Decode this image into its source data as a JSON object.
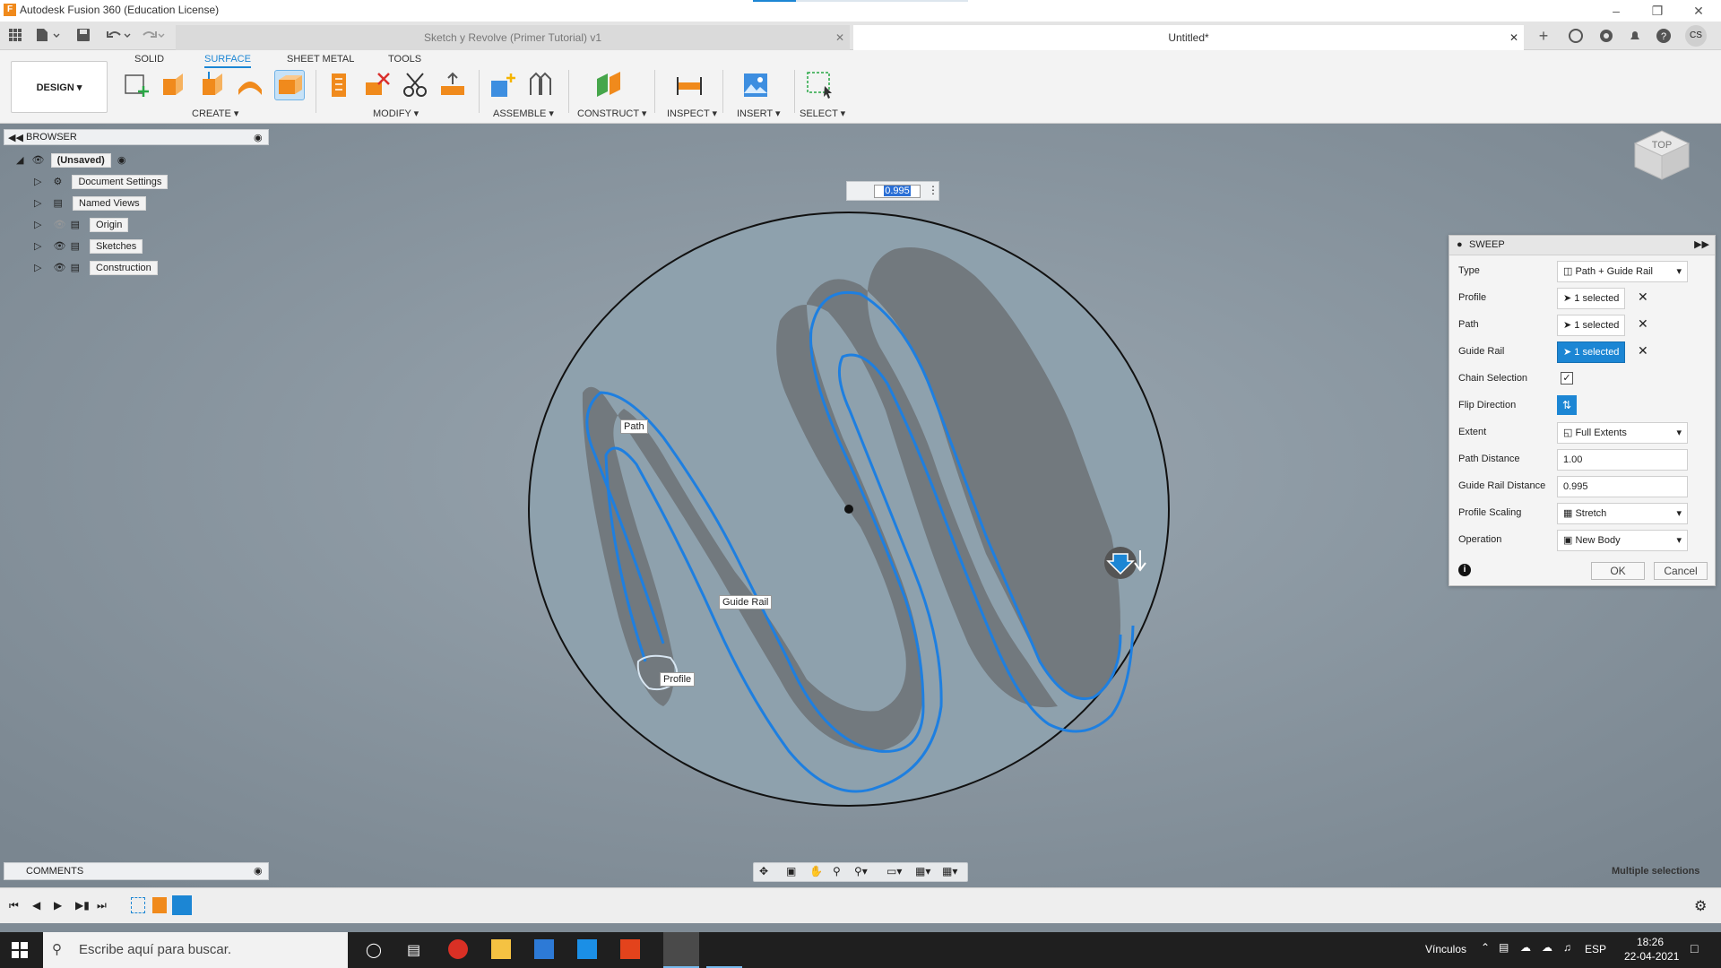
{
  "window": {
    "title": "Autodesk Fusion 360 (Education License)"
  },
  "tabs": [
    {
      "label": "Sketch y Revolve (Primer Tutorial) v1",
      "active": false
    },
    {
      "label": "Untitled*",
      "active": true
    }
  ],
  "workspace_tabs": [
    "SOLID",
    "SURFACE",
    "SHEET METAL",
    "TOOLS"
  ],
  "active_workspace_tab": "SURFACE",
  "design_button": "DESIGN",
  "toolbar_groups": [
    "CREATE",
    "MODIFY",
    "ASSEMBLE",
    "CONSTRUCT",
    "INSPECT",
    "INSERT",
    "SELECT"
  ],
  "browser": {
    "title": "BROWSER",
    "root": "(Unsaved)",
    "nodes": [
      "Document Settings",
      "Named Views",
      "Origin",
      "Sketches",
      "Construction"
    ]
  },
  "comments": "COMMENTS",
  "viewcube": "TOP",
  "distance_input": "0.995",
  "callouts": {
    "path": "Path",
    "guide_rail": "Guide Rail",
    "profile": "Profile"
  },
  "sweep": {
    "title": "SWEEP",
    "rows": [
      {
        "label": "Type",
        "value": "Path + Guide Rail"
      },
      {
        "label": "Profile",
        "value": "1 selected"
      },
      {
        "label": "Path",
        "value": "1 selected"
      },
      {
        "label": "Guide Rail",
        "value": "1 selected"
      },
      {
        "label": "Chain Selection",
        "value": ""
      },
      {
        "label": "Flip Direction",
        "value": ""
      },
      {
        "label": "Extent",
        "value": "Full Extents"
      },
      {
        "label": "Path Distance",
        "value": "1.00"
      },
      {
        "label": "Guide Rail Distance",
        "value": "0.995"
      },
      {
        "label": "Profile Scaling",
        "value": "Stretch"
      },
      {
        "label": "Operation",
        "value": "New Body"
      }
    ],
    "ok": "OK",
    "cancel": "Cancel"
  },
  "status": "Multiple selections",
  "taskbar": {
    "search_placeholder": "Escribe aquí para buscar.",
    "links": "Vínculos",
    "lang": "ESP",
    "time": "18:26",
    "date": "22-04-2021"
  },
  "user_initials": "CS",
  "colors": {
    "accent": "#1c86d4",
    "path_blue": "#1e7fe0",
    "body_grey": "#6f7479"
  }
}
